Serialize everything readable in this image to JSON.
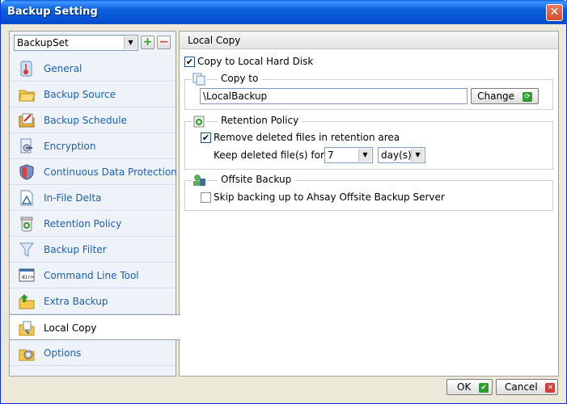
{
  "window": {
    "title": "Backup Setting",
    "close_glyph": "✕"
  },
  "backup_set": {
    "selected": "BackupSet",
    "add_glyph": "+",
    "remove_glyph": "−"
  },
  "nav": {
    "items": [
      {
        "label": "General",
        "icon": "general-icon"
      },
      {
        "label": "Backup Source",
        "icon": "folder-icon"
      },
      {
        "label": "Backup Schedule",
        "icon": "schedule-icon"
      },
      {
        "label": "Encryption",
        "icon": "encryption-icon"
      },
      {
        "label": "Continuous Data Protection",
        "icon": "shield-icon"
      },
      {
        "label": "In-File Delta",
        "icon": "document-icon"
      },
      {
        "label": "Retention Policy",
        "icon": "recycle-bin-icon"
      },
      {
        "label": "Backup Filter",
        "icon": "funnel-icon"
      },
      {
        "label": "Command Line Tool",
        "icon": "terminal-icon"
      },
      {
        "label": "Extra Backup",
        "icon": "extra-backup-icon"
      },
      {
        "label": "Local Copy",
        "icon": "local-copy-icon"
      },
      {
        "label": "Options",
        "icon": "options-gear-icon"
      }
    ],
    "active_index": 10
  },
  "main": {
    "section_title": "Local Copy",
    "copy_to_local": {
      "label": "Copy to Local Hard Disk",
      "checked": true
    },
    "copy_to": {
      "title": "Copy to",
      "path": "\\LocalBackup",
      "change_label": "Change"
    },
    "retention": {
      "title": "Retention Policy",
      "remove_label": "Remove deleted files in retention area",
      "remove_checked": true,
      "keep_label": "Keep deleted file(s) for :",
      "keep_value": "7",
      "unit": "day(s)"
    },
    "offsite": {
      "title": "Offsite Backup",
      "skip_label": "Skip backing up to Ahsay Offsite Backup Server",
      "skip_checked": false
    }
  },
  "footer": {
    "ok_label": "OK",
    "cancel_label": "Cancel"
  },
  "colors": {
    "title_bar": "#0a5fd8",
    "nav_text": "#1a5fb4",
    "accent_green": "#2e9c2e",
    "accent_red": "#d63b3b"
  }
}
